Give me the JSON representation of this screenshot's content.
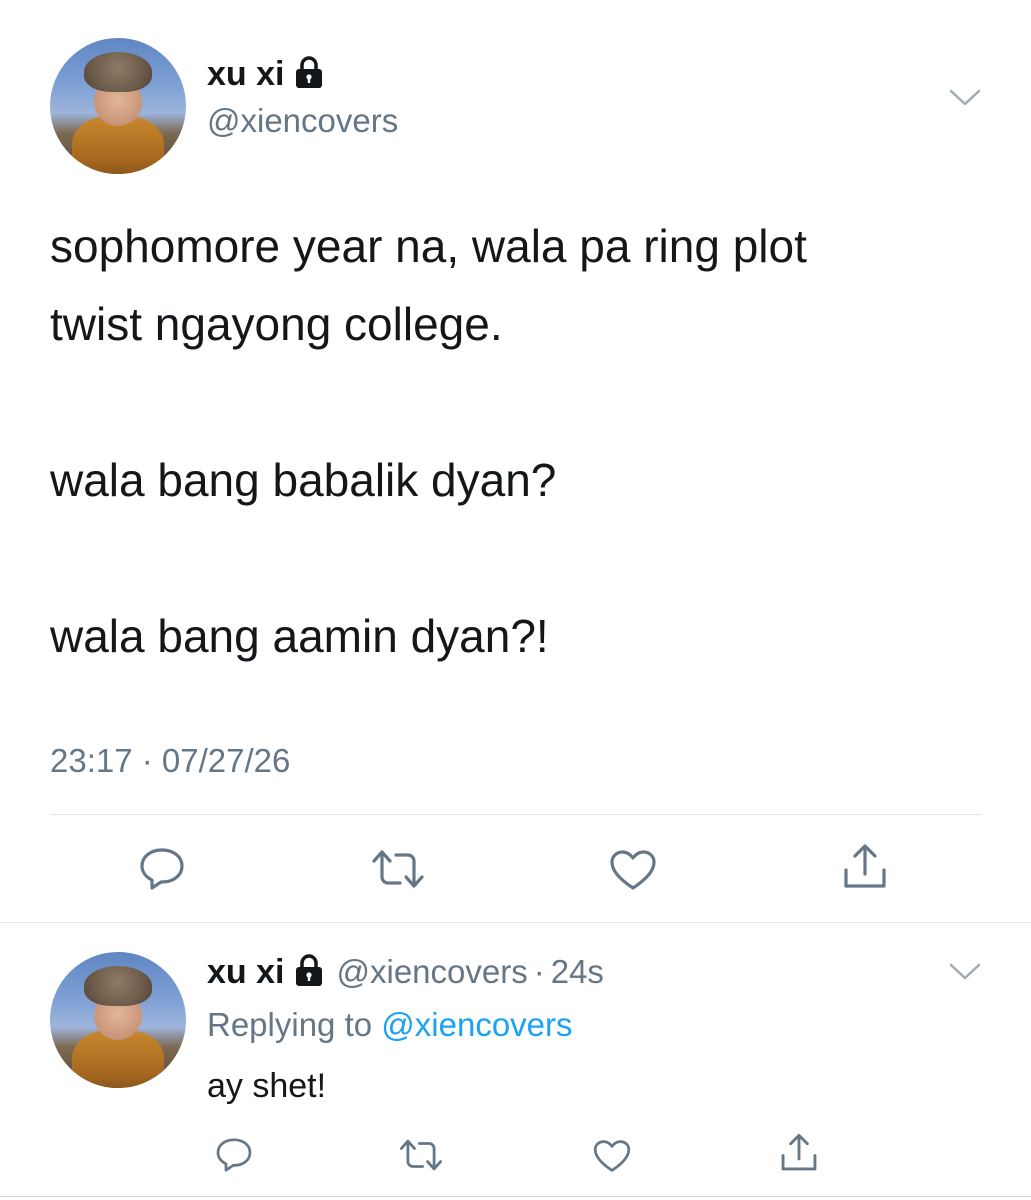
{
  "tweet": {
    "author_name": "xu xi",
    "author_handle": "@xiencovers",
    "text": "sophomore year na, wala pa ring plot\ntwist ngayong college.\n\nwala bang babalik dyan?\n\nwala bang aamin dyan?!",
    "timestamp": "23:17 · 07/27/26",
    "actions": [
      "reply-icon",
      "retweet-icon",
      "like-icon",
      "share-icon"
    ]
  },
  "reply": {
    "author_name": "xu xi",
    "author_handle": "@xiencovers",
    "separator": "·",
    "age": "24s",
    "replying_prefix": "Replying to",
    "replying_to": "@xiencovers",
    "text": "ay shet!"
  },
  "colors": {
    "text": "#14171a",
    "secondary": "#657786",
    "link": "#1da1f2",
    "divider": "#e1e8ed"
  }
}
